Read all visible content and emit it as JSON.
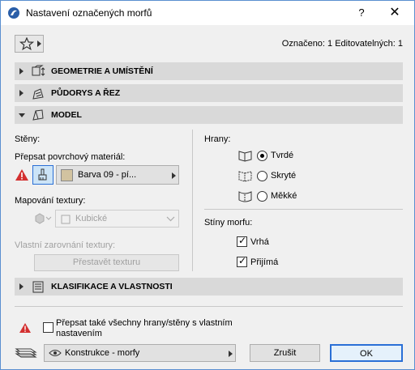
{
  "window": {
    "title": "Nastavení označených morfů",
    "help_label": "?",
    "close_label": "✕"
  },
  "toolbar": {
    "selection_info": "Označeno: 1 Editovatelných: 1"
  },
  "sections": {
    "geometry": "GEOMETRIE A UMÍSTĚNÍ",
    "floorplan": "PŮDORYS A ŘEZ",
    "model": "MODEL",
    "classification": "KLASIFIKACE A VLASTNOSTI"
  },
  "model": {
    "walls_label": "Stěny:",
    "override_material_label": "Přepsat povrchový materiál:",
    "material_value": "Barva 09 - pí...",
    "texture_mapping_label": "Mapování textury:",
    "texture_mapping_value": "Kubické",
    "custom_alignment_label": "Vlastní zarovnání textury:",
    "rebuild_texture_button": "Přestavět texturu",
    "edges_label": "Hrany:",
    "edges_options": [
      "Tvrdé",
      "Skryté",
      "Měkké"
    ],
    "edges_selected": "Tvrdé",
    "shadows_label": "Stíny morfu:",
    "shadow_cast_label": "Vrhá",
    "shadow_cast_checked": true,
    "shadow_receive_label": "Přijímá",
    "shadow_receive_checked": true
  },
  "footer": {
    "override_all_label_line1": "Přepsat také všechny hrany/stěny s vlastním",
    "override_all_label_line2": "nastavením",
    "override_all_checked": false,
    "layer_value": "Konstrukce - morfy",
    "cancel_label": "Zrušit",
    "ok_label": "OK"
  },
  "colors": {
    "section_bg": "#d9d9d9",
    "warning_red": "#d32f2f",
    "material_swatch": "#d2c3a0",
    "accent_blue": "#2a6fd6"
  }
}
